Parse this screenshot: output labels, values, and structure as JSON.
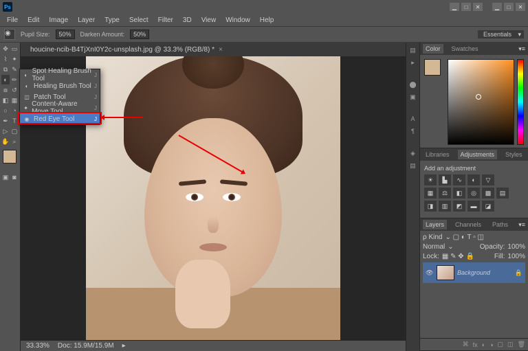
{
  "app": {
    "logo": "Ps"
  },
  "window_buttons": {
    "min": "▁",
    "max": "□",
    "close": "✕"
  },
  "menu": [
    "File",
    "Edit",
    "Image",
    "Layer",
    "Type",
    "Select",
    "Filter",
    "3D",
    "View",
    "Window",
    "Help"
  ],
  "options_bar": {
    "pupil_label": "Pupil Size:",
    "pupil_value": "50%",
    "darken_label": "Darken Amount:",
    "darken_value": "50%",
    "workspace": "Essentials"
  },
  "document": {
    "tab_title": "houcine-ncib-B4TjXnI0Y2c-unsplash.jpg @ 33.3% (RGB/8) *",
    "zoom": "33.33%",
    "doc_size": "Doc: 15.9M/15.9M"
  },
  "tool_flyout": {
    "items": [
      {
        "icon": "◐",
        "label": "Spot Healing Brush Tool",
        "shortcut": "J"
      },
      {
        "icon": "◐",
        "label": "Healing Brush Tool",
        "shortcut": "J"
      },
      {
        "icon": "◫",
        "label": "Patch Tool",
        "shortcut": "J"
      },
      {
        "icon": "✦",
        "label": "Content-Aware Move Tool",
        "shortcut": "J"
      },
      {
        "icon": "◉",
        "label": "Red Eye Tool",
        "shortcut": "J"
      }
    ],
    "selected_index": 4
  },
  "panels": {
    "color_tabs": [
      "Color",
      "Swatches"
    ],
    "adj_tabs": [
      "Libraries",
      "Adjustments",
      "Styles"
    ],
    "adj_title": "Add an adjustment",
    "layer_tabs": [
      "Layers",
      "Channels",
      "Paths"
    ],
    "layer_kind": "ρ Kind",
    "layer_blend": "Normal",
    "layer_opacity_label": "Opacity:",
    "layer_opacity": "100%",
    "layer_lock_label": "Lock:",
    "layer_fill_label": "Fill:",
    "layer_fill": "100%",
    "layer_name": "Background"
  }
}
